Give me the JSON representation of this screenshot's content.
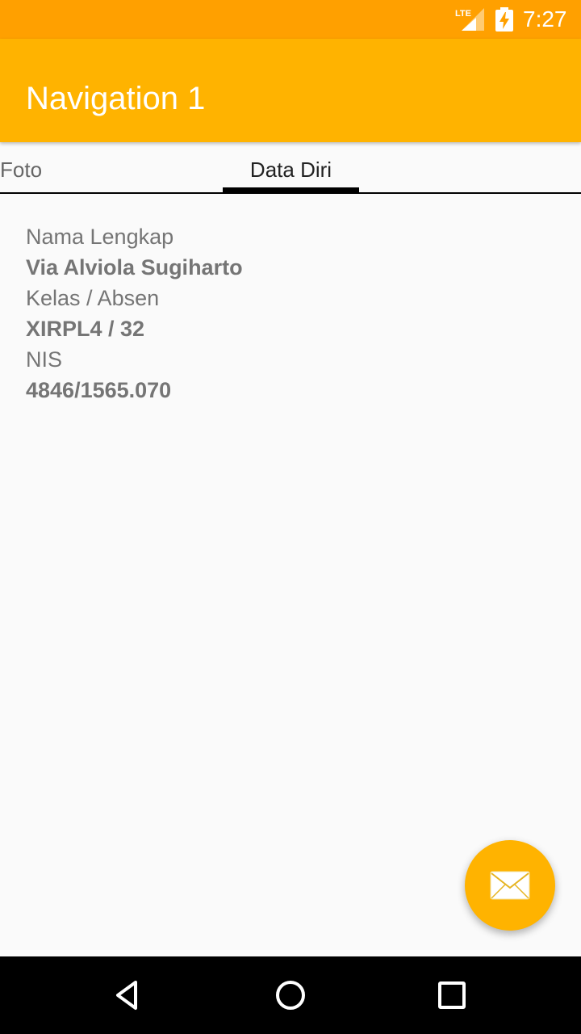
{
  "status_bar": {
    "network": "LTE",
    "time": "7:27",
    "network_icon": "lte-signal-icon",
    "battery_icon": "battery-charging-icon"
  },
  "app_bar": {
    "title": "Navigation 1"
  },
  "tabs": [
    {
      "label": "Foto",
      "selected": false
    },
    {
      "label": "Data Diri",
      "selected": true
    }
  ],
  "profile": {
    "fields": [
      {
        "label": "Nama Lengkap",
        "value": "Via Alviola Sugiharto"
      },
      {
        "label": "Kelas / Absen",
        "value": "XIRPL4 / 32"
      },
      {
        "label": "NIS",
        "value": "4846/1565.070"
      }
    ]
  },
  "fab": {
    "icon": "envelope-icon"
  },
  "nav_bar": {
    "icons": [
      "back-icon",
      "home-icon",
      "recent-apps-icon"
    ]
  },
  "colors": {
    "status_bar": "#ffa000",
    "app_bar": "#ffb300",
    "accent": "#ffb300",
    "background": "#fafafa",
    "text_secondary": "#757575"
  }
}
